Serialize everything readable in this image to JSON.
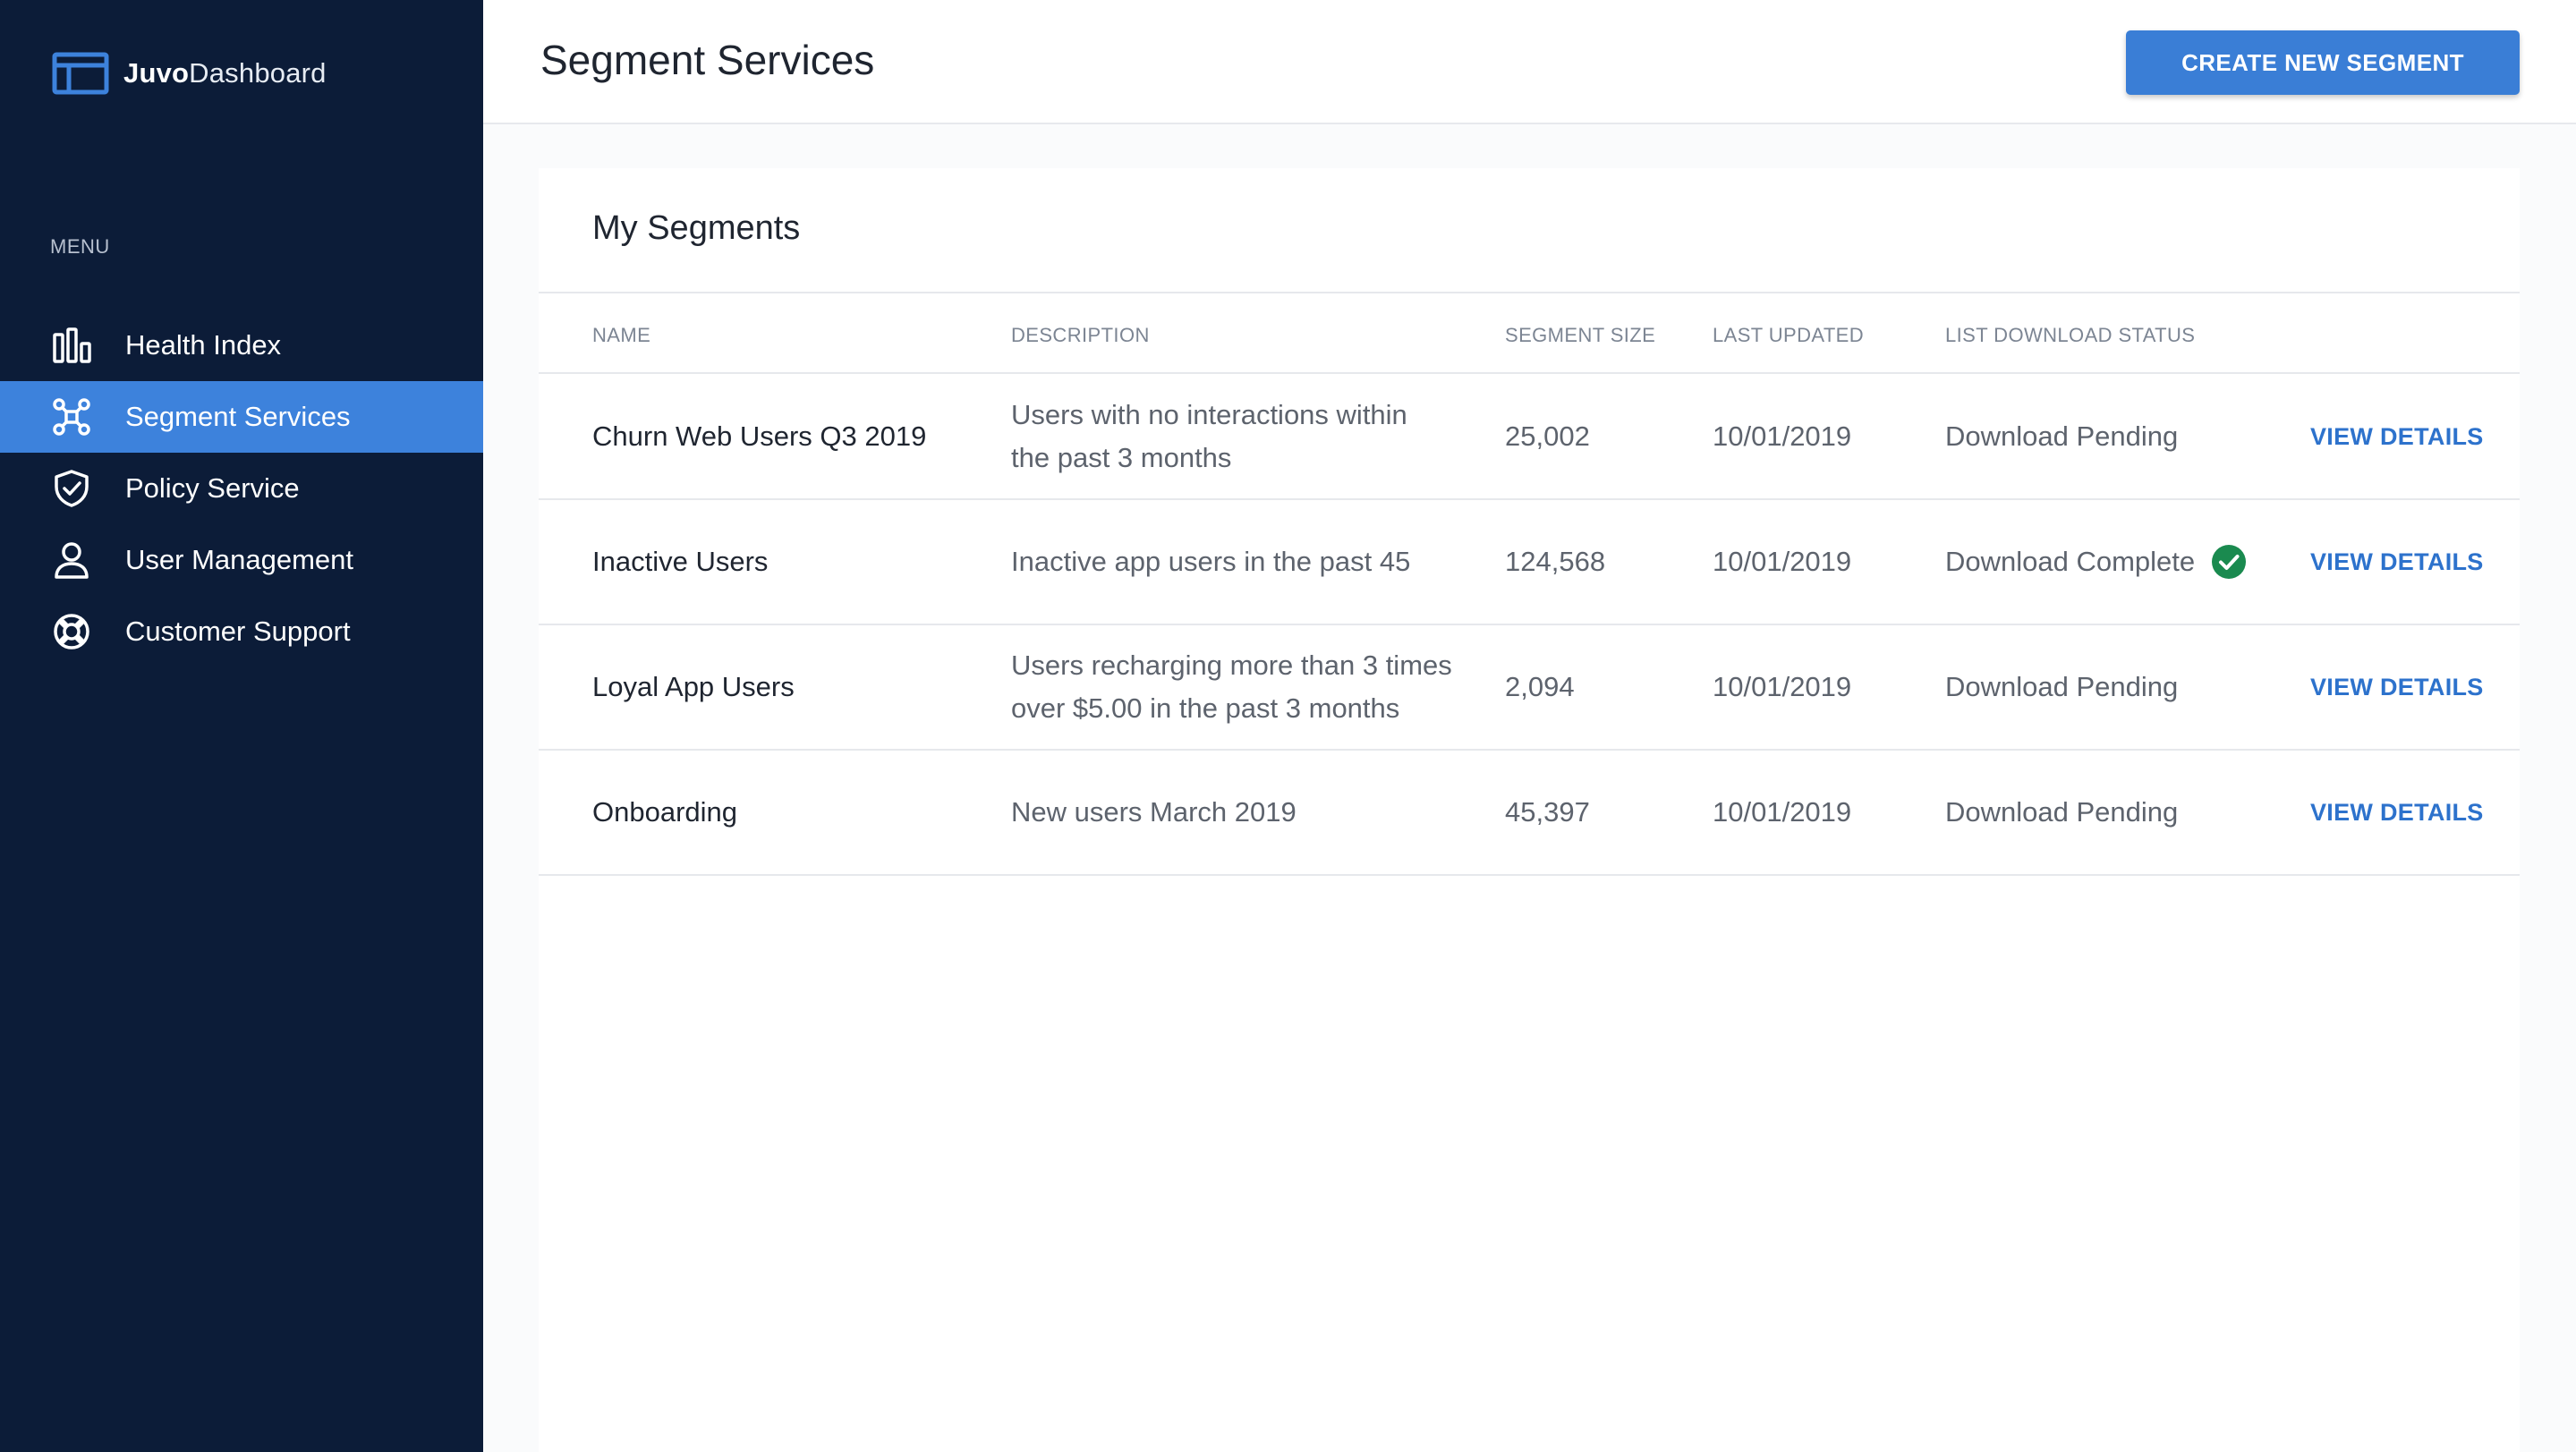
{
  "brand": {
    "name_bold": "Juvo",
    "name_rest": "Dashboard"
  },
  "sidebar": {
    "menu_label": "MENU",
    "items": [
      {
        "label": "Health Index",
        "icon": "bar-chart-icon",
        "active": false
      },
      {
        "label": "Segment Services",
        "icon": "network-icon",
        "active": true
      },
      {
        "label": "Policy Service",
        "icon": "shield-icon",
        "active": false
      },
      {
        "label": "User Management",
        "icon": "user-icon",
        "active": false
      },
      {
        "label": "Customer Support",
        "icon": "lifebuoy-icon",
        "active": false
      }
    ]
  },
  "header": {
    "title": "Segment Services",
    "create_button_label": "CREATE NEW SEGMENT"
  },
  "segments": {
    "title": "My Segments",
    "columns": {
      "name": "NAME",
      "description": "DESCRIPTION",
      "size": "SEGMENT SIZE",
      "updated": "LAST UPDATED",
      "status": "LIST DOWNLOAD STATUS"
    },
    "rows": [
      {
        "name": "Churn Web Users Q3 2019",
        "description_line1": "Users with no interactions within",
        "description_line2": "the past 3 months",
        "size": "25,002",
        "updated": "10/01/2019",
        "status": "Download Pending",
        "action": "VIEW DETAILS"
      },
      {
        "name": "Inactive Users",
        "description_line1": "Inactive app users in the past 45",
        "description_line2": "",
        "size": "124,568",
        "updated": "10/01/2019",
        "status": "Download Complete",
        "action": "VIEW DETAILS"
      },
      {
        "name": "Loyal App Users",
        "description_line1": "Users recharging more than 3 times",
        "description_line2": "over $5.00 in the past 3 months",
        "size": "2,094",
        "updated": "10/01/2019",
        "status": "Download Pending",
        "action": "VIEW DETAILS"
      },
      {
        "name": "Onboarding",
        "description_line1": "New users March 2019",
        "description_line2": "",
        "size": "45,397",
        "updated": "10/01/2019",
        "status": "Download Pending",
        "action": "VIEW DETAILS"
      }
    ]
  },
  "colors": {
    "sidebar_bg": "#0c1c38",
    "active_item": "#3d82dc",
    "primary_button": "#3a7ed6",
    "link": "#2d72cc",
    "success": "#1a8a4f"
  }
}
